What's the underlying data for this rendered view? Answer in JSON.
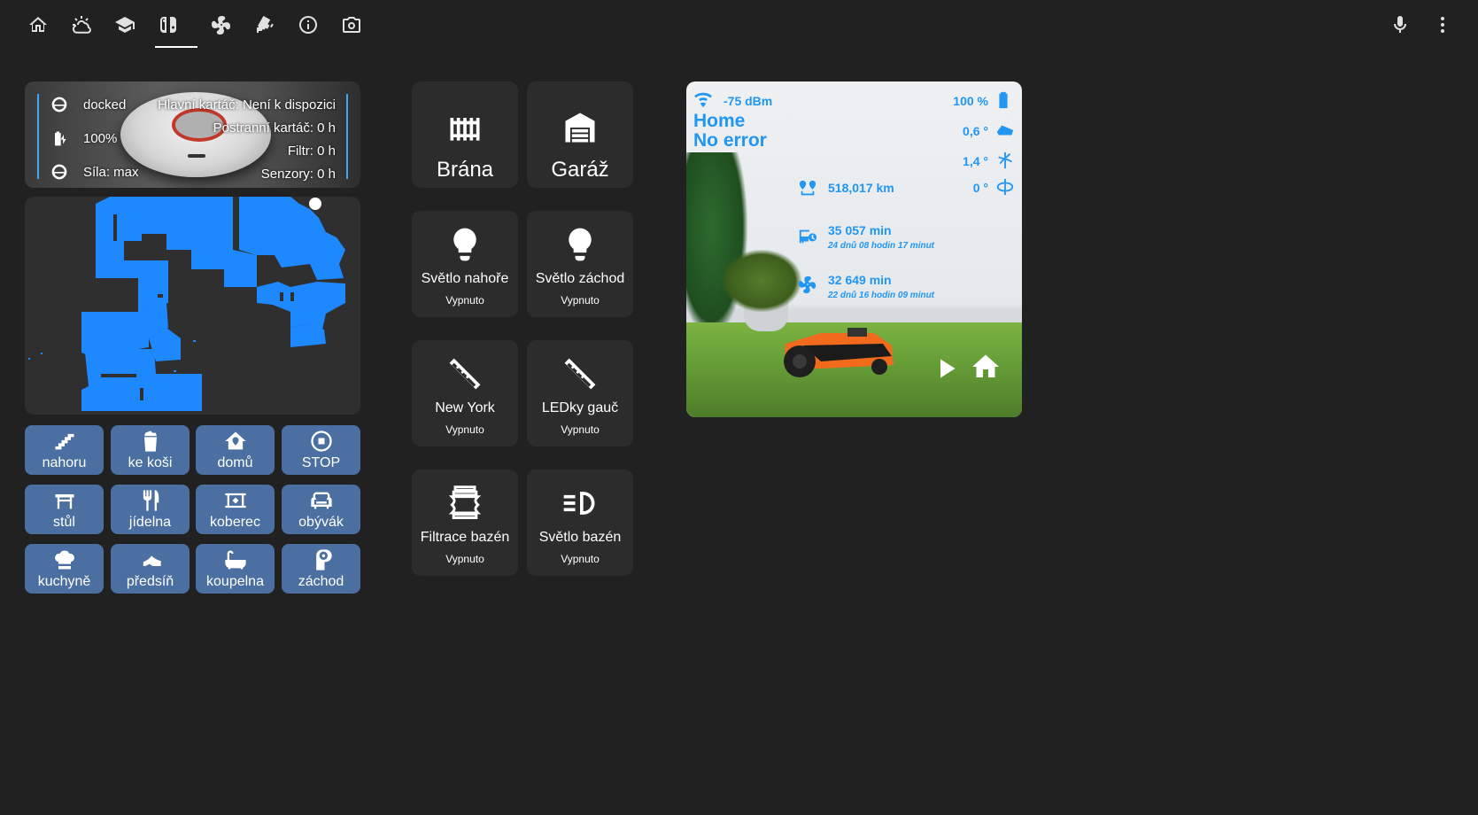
{
  "topbar": {
    "tabs": [
      {
        "icon": "home-icon"
      },
      {
        "icon": "weather-partly-cloudy-icon"
      },
      {
        "icon": "school-icon"
      },
      {
        "icon": "nintendo-switch-icon",
        "active": true
      },
      {
        "icon": "air-conditioner-icon",
        "text": "A/C"
      },
      {
        "icon": "cctv-icon"
      },
      {
        "icon": "information-icon"
      },
      {
        "icon": "camera-icon"
      }
    ],
    "actions": [
      {
        "icon": "microphone-icon"
      },
      {
        "icon": "dots-vertical-icon"
      }
    ]
  },
  "vacuum": {
    "status": "docked",
    "battery": "100%",
    "fan": "Síla: max",
    "main_brush": "Hlavní kartáč: Není k dispozici",
    "side_brush": "Postranní kartáč: 0 h",
    "filter": "Filtr: 0 h",
    "sensors": "Senzory: 0 h",
    "accent": "#42a5f5"
  },
  "map": {
    "room_color": "#1e88ff",
    "background": "#2f2f2f"
  },
  "rooms": [
    {
      "label": "nahoru",
      "icon": "stairs-icon"
    },
    {
      "label": "ke koši",
      "icon": "trash-can-icon"
    },
    {
      "label": "domů",
      "icon": "home-map-marker-icon"
    },
    {
      "label": "STOP",
      "icon": "stop-circle-icon"
    },
    {
      "label": "stůl",
      "icon": "table-icon"
    },
    {
      "label": "jídelna",
      "icon": "silverware-icon"
    },
    {
      "label": "koberec",
      "icon": "rug-icon"
    },
    {
      "label": "obývák",
      "icon": "sofa-icon"
    },
    {
      "label": "kuchyně",
      "icon": "chef-hat-icon"
    },
    {
      "label": "předsíň",
      "icon": "shoe-heel-icon"
    },
    {
      "label": "koupelna",
      "icon": "bathtub-icon"
    },
    {
      "label": "záchod",
      "icon": "toilet-paper-icon"
    }
  ],
  "tiles": [
    {
      "name": "Brána",
      "icon": "gate-icon",
      "big": true
    },
    {
      "name": "Garáž",
      "icon": "garage-icon",
      "big": true
    },
    {
      "name": "Světlo nahoře",
      "state": "Vypnuto",
      "icon": "lightbulb-icon"
    },
    {
      "name": "Světlo záchod",
      "state": "Vypnuto",
      "icon": "lightbulb-icon"
    },
    {
      "name": "New York",
      "state": "Vypnuto",
      "icon": "led-strip-icon"
    },
    {
      "name": "LEDky gauč",
      "state": "Vypnuto",
      "icon": "led-strip-icon"
    },
    {
      "name": "Filtrace bazén",
      "state": "Vypnuto",
      "icon": "filter-icon"
    },
    {
      "name": "Světlo bazén",
      "state": "Vypnuto",
      "icon": "headlight-icon"
    }
  ],
  "mower": {
    "wifi": "-75 dBm",
    "battery": "100 %",
    "zone": "Home",
    "error": "No error",
    "pitch": "0,6 °",
    "roll": "1,4 °",
    "yaw": "0 °",
    "distance": "518,017 km",
    "work_time": "35 057 min",
    "work_time_detail": "24 dnů 08 hodin 17 minut",
    "blade_time": "32 649 min",
    "blade_time_detail": "22 dnů 16 hodin 09 minut",
    "accent": "#2196f3"
  }
}
